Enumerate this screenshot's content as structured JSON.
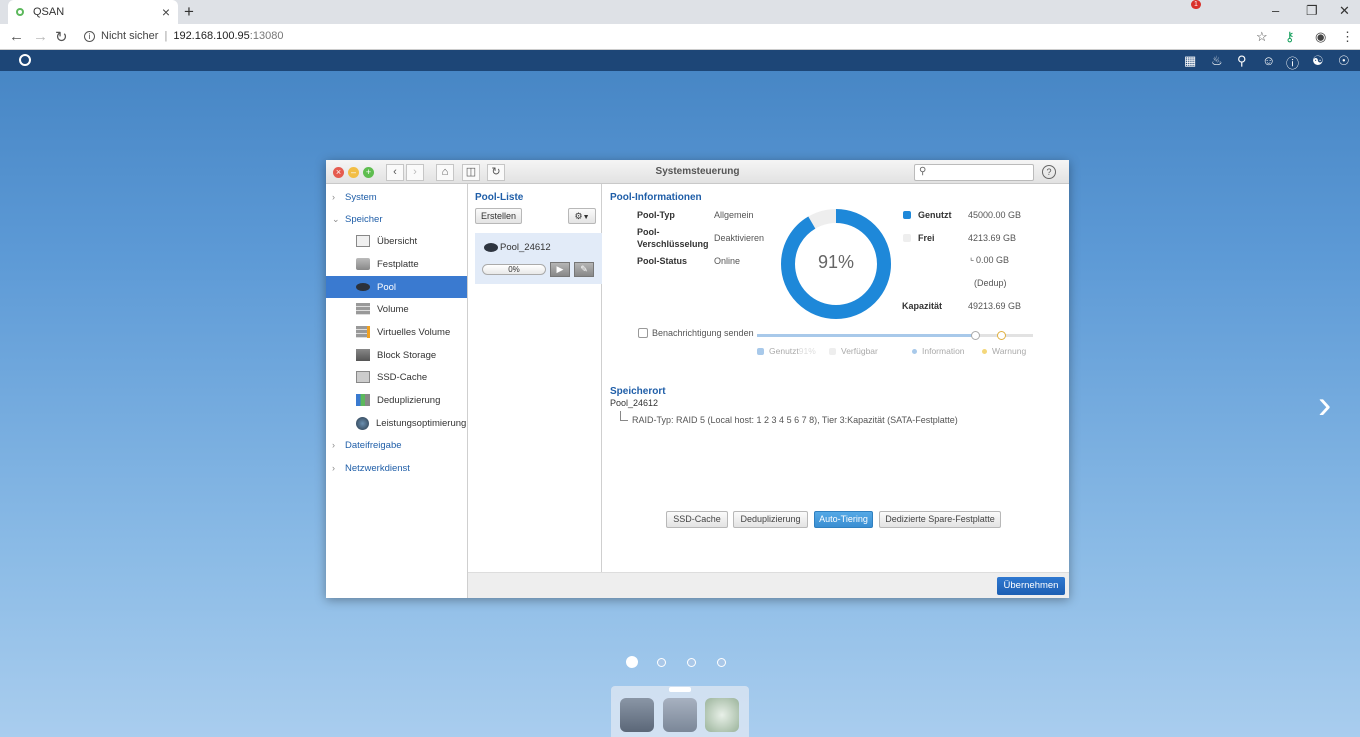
{
  "browser": {
    "tab_title": "QSAN",
    "tab_close": "×",
    "new_tab": "+",
    "security": "Nicht sicher",
    "url_host": "192.168.100.95",
    "url_port": ":13080"
  },
  "topbar": {
    "notification_count": "1"
  },
  "window": {
    "title": "Systemsteuerung",
    "search_placeholder": ""
  },
  "sidebar": {
    "groups": {
      "system": "System",
      "speicher": "Speicher",
      "dateifreigabe": "Dateifreigabe",
      "netzwerkdienst": "Netzwerkdienst"
    },
    "items": [
      {
        "label": "Übersicht"
      },
      {
        "label": "Festplatte"
      },
      {
        "label": "Pool"
      },
      {
        "label": "Volume"
      },
      {
        "label": "Virtuelles Volume"
      },
      {
        "label": "Block Storage"
      },
      {
        "label": "SSD-Cache"
      },
      {
        "label": "Deduplizierung"
      },
      {
        "label": "Leistungsoptimierung"
      }
    ],
    "active_item": "Pool"
  },
  "pool_list": {
    "heading": "Pool-Liste",
    "create_label": "Erstellen",
    "pools": [
      {
        "name": "Pool_24612",
        "progress": "0%"
      }
    ]
  },
  "pool_info": {
    "heading": "Pool-Informationen",
    "type_label": "Pool-Typ",
    "type_value": "Allgemein",
    "encryption_label_1": "Pool-",
    "encryption_label_2": "Verschlüsselung",
    "encryption_value": "Deaktivieren",
    "status_label": "Pool-Status",
    "status_value": "Online",
    "usage_percent": "91%",
    "used_fraction": 0.9144,
    "used_label": "Genutzt",
    "used_value": "45000.00 GB",
    "free_label": "Frei",
    "free_value": "4213.69 GB",
    "dedup_value": "0.00 GB",
    "dedup_label": "(Dedup)",
    "capacity_label": "Kapazität",
    "capacity_value": "49213.69 GB",
    "notify_label": "Benachrichtigung senden",
    "legend": {
      "used": "Genutzt",
      "used_pct": "91%",
      "available": "Verfügbar",
      "information": "Information",
      "warning": "Warnung"
    },
    "colors": {
      "used": "#1e88d9",
      "free": "#eeeeee"
    }
  },
  "location": {
    "heading": "Speicherort",
    "pool_name": "Pool_24612",
    "raid_text": "RAID-Typ: RAID 5 (Local host: 1 2 3 4 5 6 7 8), Tier 3:Kapazität (SATA-Festplatte)"
  },
  "actions": {
    "ssd_cache": "SSD-Cache",
    "dedup": "Deduplizierung",
    "auto_tiering": "Auto-Tiering",
    "spare": "Dedizierte Spare-Festplatte"
  },
  "footer": {
    "apply_label": "Übernehmen"
  }
}
